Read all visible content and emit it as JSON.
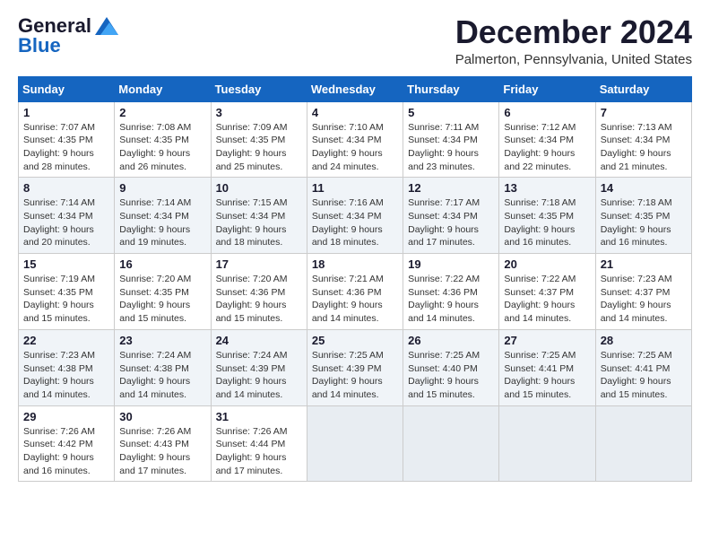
{
  "header": {
    "logo_line1": "General",
    "logo_line2": "Blue",
    "month_title": "December 2024",
    "location": "Palmerton, Pennsylvania, United States"
  },
  "weekdays": [
    "Sunday",
    "Monday",
    "Tuesday",
    "Wednesday",
    "Thursday",
    "Friday",
    "Saturday"
  ],
  "weeks": [
    [
      {
        "day": "1",
        "sunrise": "7:07 AM",
        "sunset": "4:35 PM",
        "daylight": "9 hours and 28 minutes."
      },
      {
        "day": "2",
        "sunrise": "7:08 AM",
        "sunset": "4:35 PM",
        "daylight": "9 hours and 26 minutes."
      },
      {
        "day": "3",
        "sunrise": "7:09 AM",
        "sunset": "4:35 PM",
        "daylight": "9 hours and 25 minutes."
      },
      {
        "day": "4",
        "sunrise": "7:10 AM",
        "sunset": "4:34 PM",
        "daylight": "9 hours and 24 minutes."
      },
      {
        "day": "5",
        "sunrise": "7:11 AM",
        "sunset": "4:34 PM",
        "daylight": "9 hours and 23 minutes."
      },
      {
        "day": "6",
        "sunrise": "7:12 AM",
        "sunset": "4:34 PM",
        "daylight": "9 hours and 22 minutes."
      },
      {
        "day": "7",
        "sunrise": "7:13 AM",
        "sunset": "4:34 PM",
        "daylight": "9 hours and 21 minutes."
      }
    ],
    [
      {
        "day": "8",
        "sunrise": "7:14 AM",
        "sunset": "4:34 PM",
        "daylight": "9 hours and 20 minutes."
      },
      {
        "day": "9",
        "sunrise": "7:14 AM",
        "sunset": "4:34 PM",
        "daylight": "9 hours and 19 minutes."
      },
      {
        "day": "10",
        "sunrise": "7:15 AM",
        "sunset": "4:34 PM",
        "daylight": "9 hours and 18 minutes."
      },
      {
        "day": "11",
        "sunrise": "7:16 AM",
        "sunset": "4:34 PM",
        "daylight": "9 hours and 18 minutes."
      },
      {
        "day": "12",
        "sunrise": "7:17 AM",
        "sunset": "4:34 PM",
        "daylight": "9 hours and 17 minutes."
      },
      {
        "day": "13",
        "sunrise": "7:18 AM",
        "sunset": "4:35 PM",
        "daylight": "9 hours and 16 minutes."
      },
      {
        "day": "14",
        "sunrise": "7:18 AM",
        "sunset": "4:35 PM",
        "daylight": "9 hours and 16 minutes."
      }
    ],
    [
      {
        "day": "15",
        "sunrise": "7:19 AM",
        "sunset": "4:35 PM",
        "daylight": "9 hours and 15 minutes."
      },
      {
        "day": "16",
        "sunrise": "7:20 AM",
        "sunset": "4:35 PM",
        "daylight": "9 hours and 15 minutes."
      },
      {
        "day": "17",
        "sunrise": "7:20 AM",
        "sunset": "4:36 PM",
        "daylight": "9 hours and 15 minutes."
      },
      {
        "day": "18",
        "sunrise": "7:21 AM",
        "sunset": "4:36 PM",
        "daylight": "9 hours and 14 minutes."
      },
      {
        "day": "19",
        "sunrise": "7:22 AM",
        "sunset": "4:36 PM",
        "daylight": "9 hours and 14 minutes."
      },
      {
        "day": "20",
        "sunrise": "7:22 AM",
        "sunset": "4:37 PM",
        "daylight": "9 hours and 14 minutes."
      },
      {
        "day": "21",
        "sunrise": "7:23 AM",
        "sunset": "4:37 PM",
        "daylight": "9 hours and 14 minutes."
      }
    ],
    [
      {
        "day": "22",
        "sunrise": "7:23 AM",
        "sunset": "4:38 PM",
        "daylight": "9 hours and 14 minutes."
      },
      {
        "day": "23",
        "sunrise": "7:24 AM",
        "sunset": "4:38 PM",
        "daylight": "9 hours and 14 minutes."
      },
      {
        "day": "24",
        "sunrise": "7:24 AM",
        "sunset": "4:39 PM",
        "daylight": "9 hours and 14 minutes."
      },
      {
        "day": "25",
        "sunrise": "7:25 AM",
        "sunset": "4:39 PM",
        "daylight": "9 hours and 14 minutes."
      },
      {
        "day": "26",
        "sunrise": "7:25 AM",
        "sunset": "4:40 PM",
        "daylight": "9 hours and 15 minutes."
      },
      {
        "day": "27",
        "sunrise": "7:25 AM",
        "sunset": "4:41 PM",
        "daylight": "9 hours and 15 minutes."
      },
      {
        "day": "28",
        "sunrise": "7:25 AM",
        "sunset": "4:41 PM",
        "daylight": "9 hours and 15 minutes."
      }
    ],
    [
      {
        "day": "29",
        "sunrise": "7:26 AM",
        "sunset": "4:42 PM",
        "daylight": "9 hours and 16 minutes."
      },
      {
        "day": "30",
        "sunrise": "7:26 AM",
        "sunset": "4:43 PM",
        "daylight": "9 hours and 17 minutes."
      },
      {
        "day": "31",
        "sunrise": "7:26 AM",
        "sunset": "4:44 PM",
        "daylight": "9 hours and 17 minutes."
      },
      {
        "day": "",
        "sunrise": "",
        "sunset": "",
        "daylight": ""
      },
      {
        "day": "",
        "sunrise": "",
        "sunset": "",
        "daylight": ""
      },
      {
        "day": "",
        "sunrise": "",
        "sunset": "",
        "daylight": ""
      },
      {
        "day": "",
        "sunrise": "",
        "sunset": "",
        "daylight": ""
      }
    ]
  ],
  "labels": {
    "sunrise_prefix": "Sunrise: ",
    "sunset_prefix": "Sunset: ",
    "daylight_prefix": "Daylight: "
  }
}
